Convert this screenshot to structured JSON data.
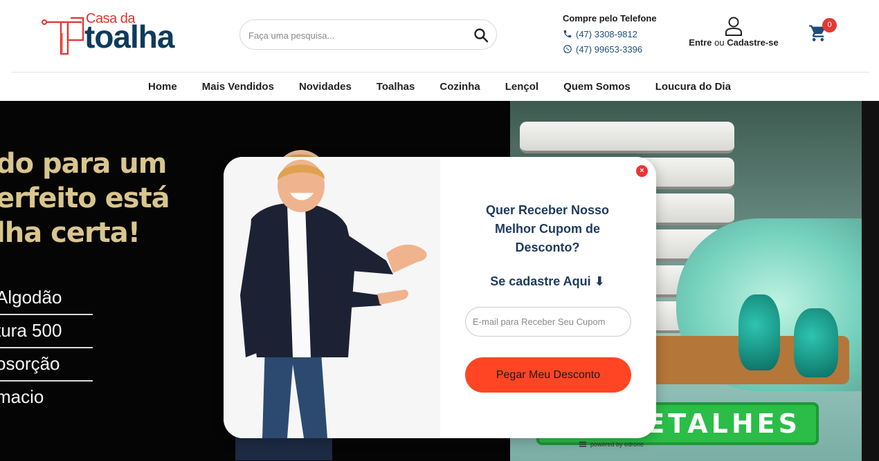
{
  "brand": {
    "logo_small": "Casa da",
    "logo_big": "toalha",
    "accent_red": "#e5322d",
    "accent_navy": "#0f3b5c"
  },
  "search": {
    "placeholder": "Faça uma pesquisa..."
  },
  "phone": {
    "title": "Compre pelo Telefone",
    "phone_number": "(47) 3308-9812",
    "whatsapp_number": "(47) 99653-3396"
  },
  "account": {
    "enter": "Entre",
    "or": "ou",
    "signup": "Cadastre-se"
  },
  "cart": {
    "count": "0"
  },
  "nav": {
    "items": [
      "Home",
      "Mais Vendidos",
      "Novidades",
      "Toalhas",
      "Cozinha",
      "Lençol",
      "Quem Somos",
      "Loucura do Dia"
    ]
  },
  "hero": {
    "headline": "do para um\nerfeito está\nlha certa!",
    "list": [
      "Algodão",
      "tura 500",
      "osorção",
      "macio"
    ],
    "cta": "ETALHES",
    "powered_by": "powered by edrone"
  },
  "popup": {
    "title": "Quer Receber Nosso Melhor Cupom de Desconto?",
    "subtitle": "Se cadastre Aqui ⬇",
    "email_placeholder": "E-mail para Receber Seu Cupom",
    "button": "Pegar Meu Desconto",
    "close": "×",
    "button_color": "#ff4524"
  }
}
